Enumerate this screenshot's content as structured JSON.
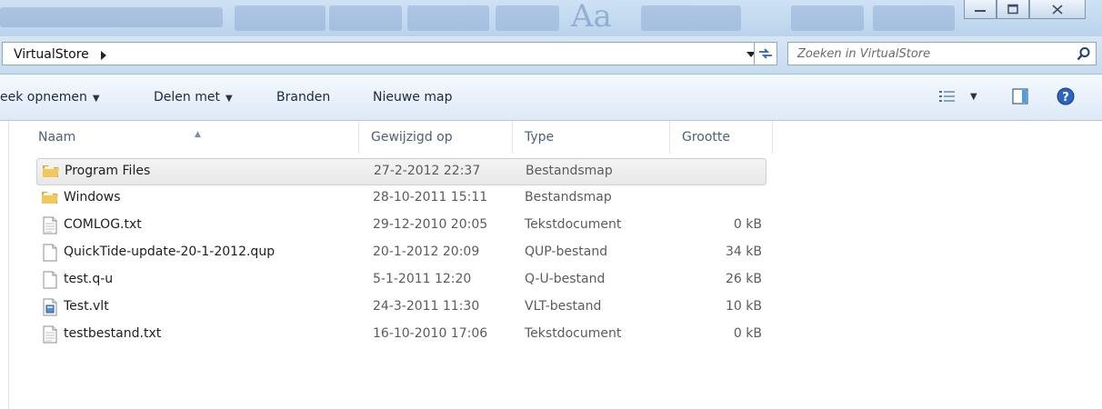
{
  "colors": {
    "folder": "#e8b84a",
    "selection": "#eaeaea",
    "header_text": "#4c607a",
    "accent": "#1e5bb0"
  },
  "window": {
    "buttons": [
      "minimize-icon",
      "maximize-icon",
      "close-icon"
    ]
  },
  "address": {
    "crumb": "VirtualStore",
    "crumb_arrow_icon": "chevron-right-icon",
    "dropdown_icon": "chevron-down-icon",
    "refresh_icon": "refresh-icon"
  },
  "search": {
    "placeholder": "Zoeken in VirtualStore",
    "icon": "search-icon"
  },
  "toolbar": {
    "items": [
      {
        "label": "eek opnemen",
        "has_caret": true
      },
      {
        "label": "Delen met",
        "has_caret": true
      },
      {
        "label": "Branden",
        "has_caret": false
      },
      {
        "label": "Nieuwe map",
        "has_caret": false
      }
    ],
    "right_icons": [
      "view-options-icon",
      "preview-pane-icon",
      "help-icon"
    ]
  },
  "columns": [
    "Naam",
    "Gewijzigd op",
    "Type",
    "Grootte"
  ],
  "sort": {
    "column": "Naam",
    "direction": "ascending"
  },
  "files": [
    {
      "name": "Program Files",
      "date": "27-2-2012 22:37",
      "type": "Bestandsmap",
      "size": "",
      "icon": "folder-icon",
      "selected": true
    },
    {
      "name": "Windows",
      "date": "28-10-2011 15:11",
      "type": "Bestandsmap",
      "size": "",
      "icon": "folder-icon",
      "selected": false
    },
    {
      "name": "COMLOG.txt",
      "date": "29-12-2010 20:05",
      "type": "Tekstdocument",
      "size": "0 kB",
      "icon": "text-file-icon",
      "selected": false
    },
    {
      "name": "QuickTide-update-20-1-2012.qup",
      "date": "20-1-2012 20:09",
      "type": "QUP-bestand",
      "size": "34 kB",
      "icon": "blank-file-icon",
      "selected": false
    },
    {
      "name": "test.q-u",
      "date": "5-1-2011 12:20",
      "type": "Q-U-bestand",
      "size": "26 kB",
      "icon": "blank-file-icon",
      "selected": false
    },
    {
      "name": "Test.vlt",
      "date": "24-3-2011 11:30",
      "type": "VLT-bestand",
      "size": "10 kB",
      "icon": "vlt-file-icon",
      "selected": false
    },
    {
      "name": "testbestand.txt",
      "date": "16-10-2010 17:06",
      "type": "Tekstdocument",
      "size": "0 kB",
      "icon": "text-file-icon",
      "selected": false
    }
  ]
}
